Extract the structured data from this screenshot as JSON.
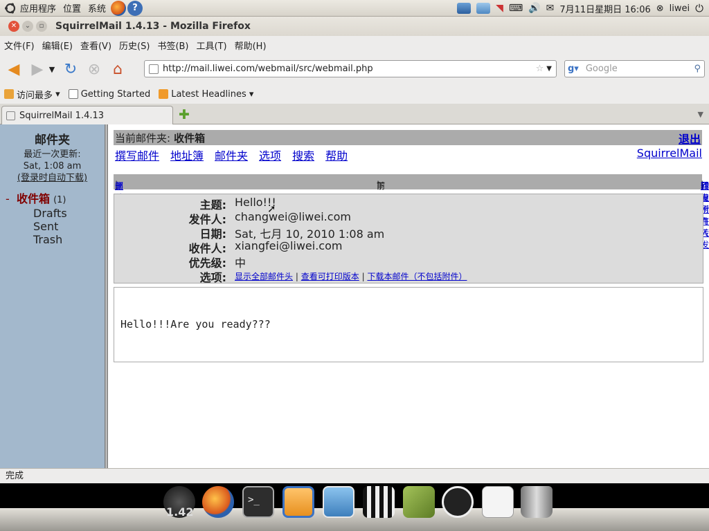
{
  "top_panel": {
    "menus": [
      "应用程序",
      "位置",
      "系统"
    ],
    "clock": "7月11日星期日 16:06",
    "user": "liwei"
  },
  "window": {
    "title": "SquirrelMail 1.4.13 - Mozilla Firefox"
  },
  "menubar": [
    "文件(F)",
    "编辑(E)",
    "查看(V)",
    "历史(S)",
    "书签(B)",
    "工具(T)",
    "帮助(H)"
  ],
  "navbar": {
    "url": "http://mail.liwei.com/webmail/src/webmail.php",
    "search_placeholder": "Google"
  },
  "bookmarks": [
    "访问最多",
    "Getting Started",
    "Latest Headlines"
  ],
  "tab": {
    "title": "SquirrelMail 1.4.13"
  },
  "left": {
    "title": "邮件夹",
    "last_update_label": "最近一次更新:",
    "last_update": "Sat, 1:08 am",
    "auto_link": "(登录时自动下载)",
    "inbox_prefix": "-",
    "inbox": "收件箱",
    "inbox_count": "(1)",
    "folders": [
      "Drafts",
      "Sent",
      "Trash"
    ]
  },
  "right": {
    "current_folder_label": "当前邮件夹:",
    "current_folder": "收件箱",
    "logout": "退出",
    "nav_links": [
      "撰写邮件",
      "地址簿",
      "邮件夹",
      "选项",
      "搜索",
      "帮助"
    ],
    "squirrelmail": "SquirrelMail",
    "actions_left": {
      "list": "邮件列表",
      "sep": "|",
      "delete": "删除"
    },
    "actions_mid": {
      "prev": "前一个",
      "sep": "|",
      "next": "下一个"
    },
    "actions_right": {
      "forward": "转发",
      "sep1": "|",
      "forward_attach": "作为附件转发",
      "sep2": "|",
      "reply": "回复",
      "sep3": "|",
      "reply_all": "回复所有人"
    },
    "headers": {
      "subject_key": "主题:",
      "subject": "Hello!!!",
      "from_key": "发件人:",
      "from": "changwei@liwei.com",
      "date_key": "日期:",
      "date": "Sat, 七月 10, 2010 1:08 am",
      "to_key": "收件人:",
      "to": "xiangfei@liwei.com",
      "priority_key": "优先级:",
      "priority": "中",
      "options_key": "选项:",
      "opt_all_headers": "显示全部邮件头",
      "opt_sep1": "|",
      "opt_print": "查看可打印版本",
      "opt_sep2": "|",
      "opt_download": "下载本邮件（不包括附件）"
    },
    "body": "Hello!!!Are you ready???"
  },
  "status": "完成",
  "dock": {
    "gauge_value": "1.42"
  }
}
